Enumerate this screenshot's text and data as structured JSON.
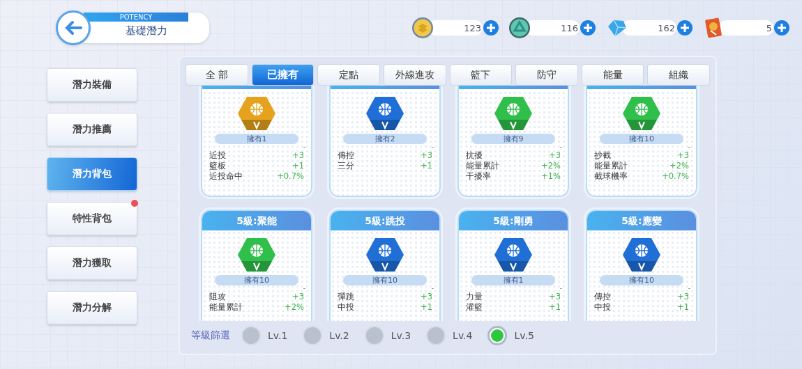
{
  "header": {
    "subtitle": "POTENCY",
    "title": "基礎潛力"
  },
  "currencies": [
    {
      "kind": "gold-coin",
      "amount": "123"
    },
    {
      "kind": "green-coin",
      "amount": "116"
    },
    {
      "kind": "diamond",
      "amount": "162"
    },
    {
      "kind": "card",
      "amount": "5"
    }
  ],
  "sidebar": {
    "items": [
      {
        "label": "潛力裝備",
        "selected": false,
        "badge": false
      },
      {
        "label": "潛力推薦",
        "selected": false,
        "badge": false
      },
      {
        "label": "潛力背包",
        "selected": true,
        "badge": false
      },
      {
        "label": "特性背包",
        "selected": false,
        "badge": true
      },
      {
        "label": "潛力獲取",
        "selected": false,
        "badge": false
      },
      {
        "label": "潛力分解",
        "selected": false,
        "badge": false
      }
    ]
  },
  "tabs": [
    {
      "label": "全 部",
      "selected": false
    },
    {
      "label": "已擁有",
      "selected": true
    },
    {
      "label": "定點",
      "selected": false
    },
    {
      "label": "外線進攻",
      "selected": false
    },
    {
      "label": "籃下",
      "selected": false
    },
    {
      "label": "防守",
      "selected": false
    },
    {
      "label": "能量",
      "selected": false
    },
    {
      "label": "組織",
      "selected": false
    }
  ],
  "cards": [
    {
      "color": "#e6a21c",
      "owned": "擁有1",
      "mark": "-",
      "stats": [
        {
          "name": "近投",
          "value": "+3"
        },
        {
          "name": "籃板",
          "value": "+1"
        },
        {
          "name": "近投命中",
          "value": "+0.7%"
        }
      ]
    },
    {
      "color": "#1f6fd6",
      "owned": "擁有2",
      "mark": "-",
      "stats": [
        {
          "name": "傳控",
          "value": "+3"
        },
        {
          "name": "三分",
          "value": "+1"
        }
      ]
    },
    {
      "color": "#2fbf4a",
      "owned": "擁有9",
      "mark": "-",
      "stats": [
        {
          "name": "抗擾",
          "value": "+3"
        },
        {
          "name": "能量累計",
          "value": "+2%"
        },
        {
          "name": "干擾率",
          "value": "+1%"
        }
      ]
    },
    {
      "color": "#2fbf4a",
      "owned": "擁有10",
      "mark": "-",
      "stats": [
        {
          "name": "抄截",
          "value": "+3"
        },
        {
          "name": "能量累計",
          "value": "+2%"
        },
        {
          "name": "截球機率",
          "value": "+0.7%"
        }
      ]
    },
    {
      "title": "5級:聚能",
      "color": "#2fbf4a",
      "owned": "擁有10",
      "mark": "-",
      "stats": [
        {
          "name": "阻攻",
          "value": "+3"
        },
        {
          "name": "能量累計",
          "value": "+2%"
        }
      ]
    },
    {
      "title": "5級:跳投",
      "color": "#1f6fd6",
      "owned": "擁有10",
      "mark": "-",
      "stats": [
        {
          "name": "彈跳",
          "value": "+3"
        },
        {
          "name": "中投",
          "value": "+1"
        }
      ]
    },
    {
      "title": "5級:剛勇",
      "color": "#1f6fd6",
      "owned": "擁有1",
      "mark": "-",
      "stats": [
        {
          "name": "力量",
          "value": "+3"
        },
        {
          "name": "灌籃",
          "value": "+1"
        }
      ]
    },
    {
      "title": "5級:應變",
      "color": "#1f6fd6",
      "owned": "擁有10",
      "mark": "-",
      "stats": [
        {
          "name": "傳控",
          "value": "+3"
        },
        {
          "name": "中投",
          "value": "+1"
        }
      ]
    }
  ],
  "filter": {
    "label": "等級篩選",
    "levels": [
      {
        "label": "Lv.1",
        "selected": false
      },
      {
        "label": "Lv.2",
        "selected": false
      },
      {
        "label": "Lv.3",
        "selected": false
      },
      {
        "label": "Lv.4",
        "selected": false
      },
      {
        "label": "Lv.5",
        "selected": true
      }
    ]
  }
}
